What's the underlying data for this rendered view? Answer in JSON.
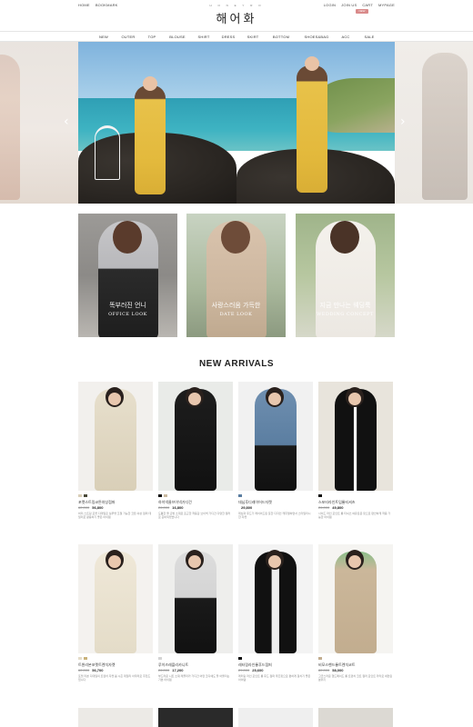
{
  "header": {
    "util_left": [
      "HOME",
      "BOOKMARK"
    ],
    "util_right": [
      "LOGIN",
      "JOIN US",
      "CART",
      "MYPAGE"
    ],
    "logo_sub": "H O N E Y R O",
    "logo_main": "해어화",
    "cart_badge": "NEW"
  },
  "nav": {
    "items": [
      "NEW",
      "OUTER",
      "TOP",
      "BLOUSE",
      "SHIRT",
      "DRESS",
      "SKIRT",
      "BOTTOM",
      "SHOES&BAG",
      "ACC",
      "SALE"
    ]
  },
  "hero": {
    "prev_arrow": "‹",
    "next_arrow": "›"
  },
  "banners": [
    {
      "ko": "똑부러진 언니",
      "en": "OFFICE LOOK"
    },
    {
      "ko": "사랑스러움 가득한",
      "en": "DATE LOOK"
    },
    {
      "ko": "지금 만나는 웨딩룩",
      "en": "WEDDING CONCEPT"
    }
  ],
  "section_title": "NEW ARRIVALS",
  "products": [
    {
      "name": "포켓스트링코튼야상점퍼",
      "old": "62,000",
      "new": "56,800",
      "desc": "허리 스트링 포켓 디테일로 실루엣 조절 가능한 코튼 야상 점퍼 데일리로 활용하기 좋은 아이템"
    },
    {
      "name": "하이넥울브이넥가디건",
      "old": "26,000",
      "new": "16,800",
      "desc": "도톰한 울 혼방 소재로 포근한 착용감 브이넥 가디건 다양한 컬러로 준비되었습니다"
    },
    {
      "name": "데님후디레이어드자켓",
      "old": "",
      "new": "29,800",
      "desc": "데님과 후드가 레이어드된 듯한 디자인 캐주얼하면서 스타일리시한 자켓"
    },
    {
      "name": "스포티라인트임롱티셔츠",
      "old": "26,000",
      "new": "49,800",
      "desc": "사이드 라인 포인트 롱 티셔츠 여유로운 핏으로 편안하게 착용 가능한 아이템"
    },
    {
      "name": "트윈리본포켓트렌치자켓",
      "old": "62,000",
      "new": "56,700",
      "desc": "포켓 리본 디테일의 트렌치 자켓 봄 시즌 데일리 아우터로 추천드립니다"
    },
    {
      "name": "루이즈레플리카니트",
      "old": "26,000",
      "new": "17,200",
      "desc": "부드러운 니트 소재 레플리카 가디건 어떤 코디에도 잘 어울리는 기본 아이템"
    },
    {
      "name": "레터링라인롱후드점퍼",
      "old": "29,000",
      "new": "25,600",
      "desc": "레터링 라인 포인트 롱 후드 점퍼 루즈핏으로 편하게 걸치기 좋은 아이템"
    },
    {
      "name": "비모스핸드롱트렌치코트",
      "old": "82,000",
      "new": "58,000",
      "desc": "고급스러운 핸드메이드 롱 트렌치 코트 컬러 포인트 카라로 세련된 분위기"
    }
  ],
  "colors": {
    "accent": "#d98a8a",
    "sea": "#3eb3c2",
    "dress_yellow": "#e3b93c"
  },
  "icons": [
    "chevron-left-icon",
    "chevron-right-icon"
  ]
}
